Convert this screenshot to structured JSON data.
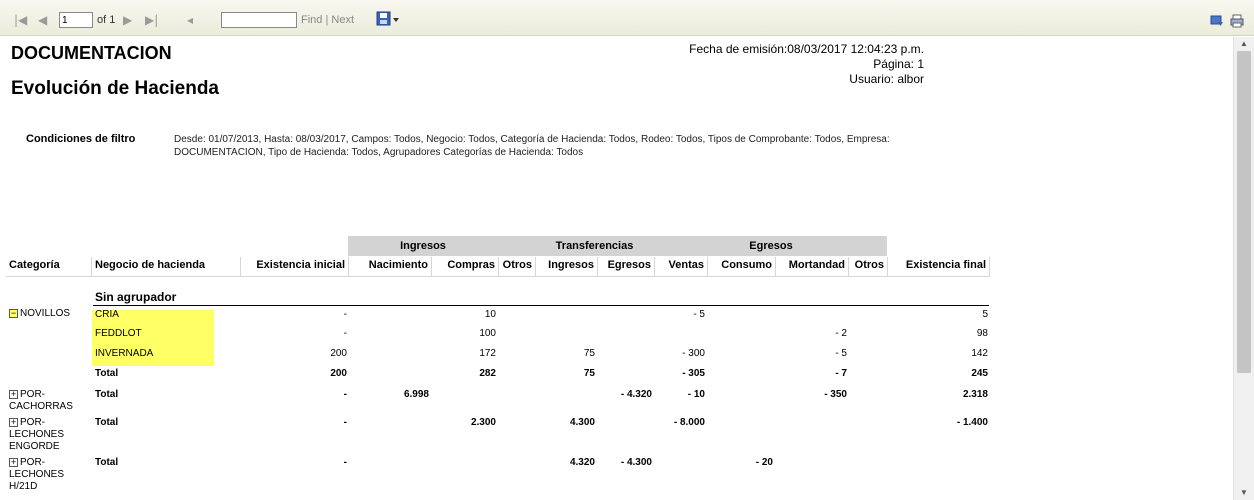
{
  "toolbar": {
    "page_value": "1",
    "page_of": "of 1",
    "find_label": "Find",
    "separator": "|",
    "next_label": "Next"
  },
  "report": {
    "title": "DOCUMENTACION",
    "subtitle": "Evolución de Hacienda",
    "emission": "Fecha de emisión:08/03/2017 12:04:23 p.m.",
    "page": "Página: 1",
    "user": "Usuario: albor",
    "filter_label": "Condiciones de filtro",
    "filter_text": "Desde: 01/07/2013, Hasta: 08/03/2017, Campos: Todos, Negocio: Todos, Categoría de Hacienda: Todos, Rodeo: Todos, Tipos de Comprobante: Todos, Empresa: DOCUMENTACION, Tipo de Hacienda: Todos, Agrupadores Categorías de Hacienda: Todos"
  },
  "table": {
    "group_headers": [
      "Ingresos",
      "Transferencias",
      "Egresos"
    ],
    "columns": [
      "Categoría",
      "Negocio de hacienda",
      "Existencia inicial",
      "Nacimiento",
      "Compras",
      "Otros",
      "Ingresos",
      "Egresos",
      "Ventas",
      "Consumo",
      "Mortandad",
      "Otros",
      "Existencia final"
    ],
    "section": "Sin agrupador",
    "rows": [
      {
        "cat": "NOVILLOS",
        "neg": "CRIA",
        "ei": "-",
        "comp": "10",
        "ventas": "- 5",
        "ef": "5"
      },
      {
        "neg": "FEDDLOT",
        "ei": "-",
        "comp": "100",
        "mort": "- 2",
        "ef": "98"
      },
      {
        "neg": "INVERNADA",
        "ei": "200",
        "comp": "172",
        "ting": "75",
        "ventas": "- 300",
        "mort": "- 5",
        "ef": "142"
      },
      {
        "neg": "Total",
        "ei": "200",
        "comp": "282",
        "ting": "75",
        "ventas": "- 305",
        "mort": "- 7",
        "ef": "245"
      },
      {
        "cat": "POR-\nCACHORRAS",
        "neg": "Total",
        "ei": "-",
        "nac": "6.998",
        "tegr": "- 4.320",
        "ventas": "- 10",
        "mort": "- 350",
        "ef": "2.318"
      },
      {
        "cat": "POR-\nLECHONES\nENGORDE",
        "neg": "Total",
        "ei": "-",
        "comp": "2.300",
        "ting": "4.300",
        "ventas": "- 8.000",
        "ef": "- 1.400"
      },
      {
        "cat": "POR-\nLECHONES\nH/21D",
        "neg": "Total",
        "ei": "-",
        "ting": "4.320",
        "tegr": "- 4.300",
        "cons": "- 20"
      }
    ],
    "expand_symbols": {
      "collapse": "−",
      "expand": "+"
    }
  }
}
